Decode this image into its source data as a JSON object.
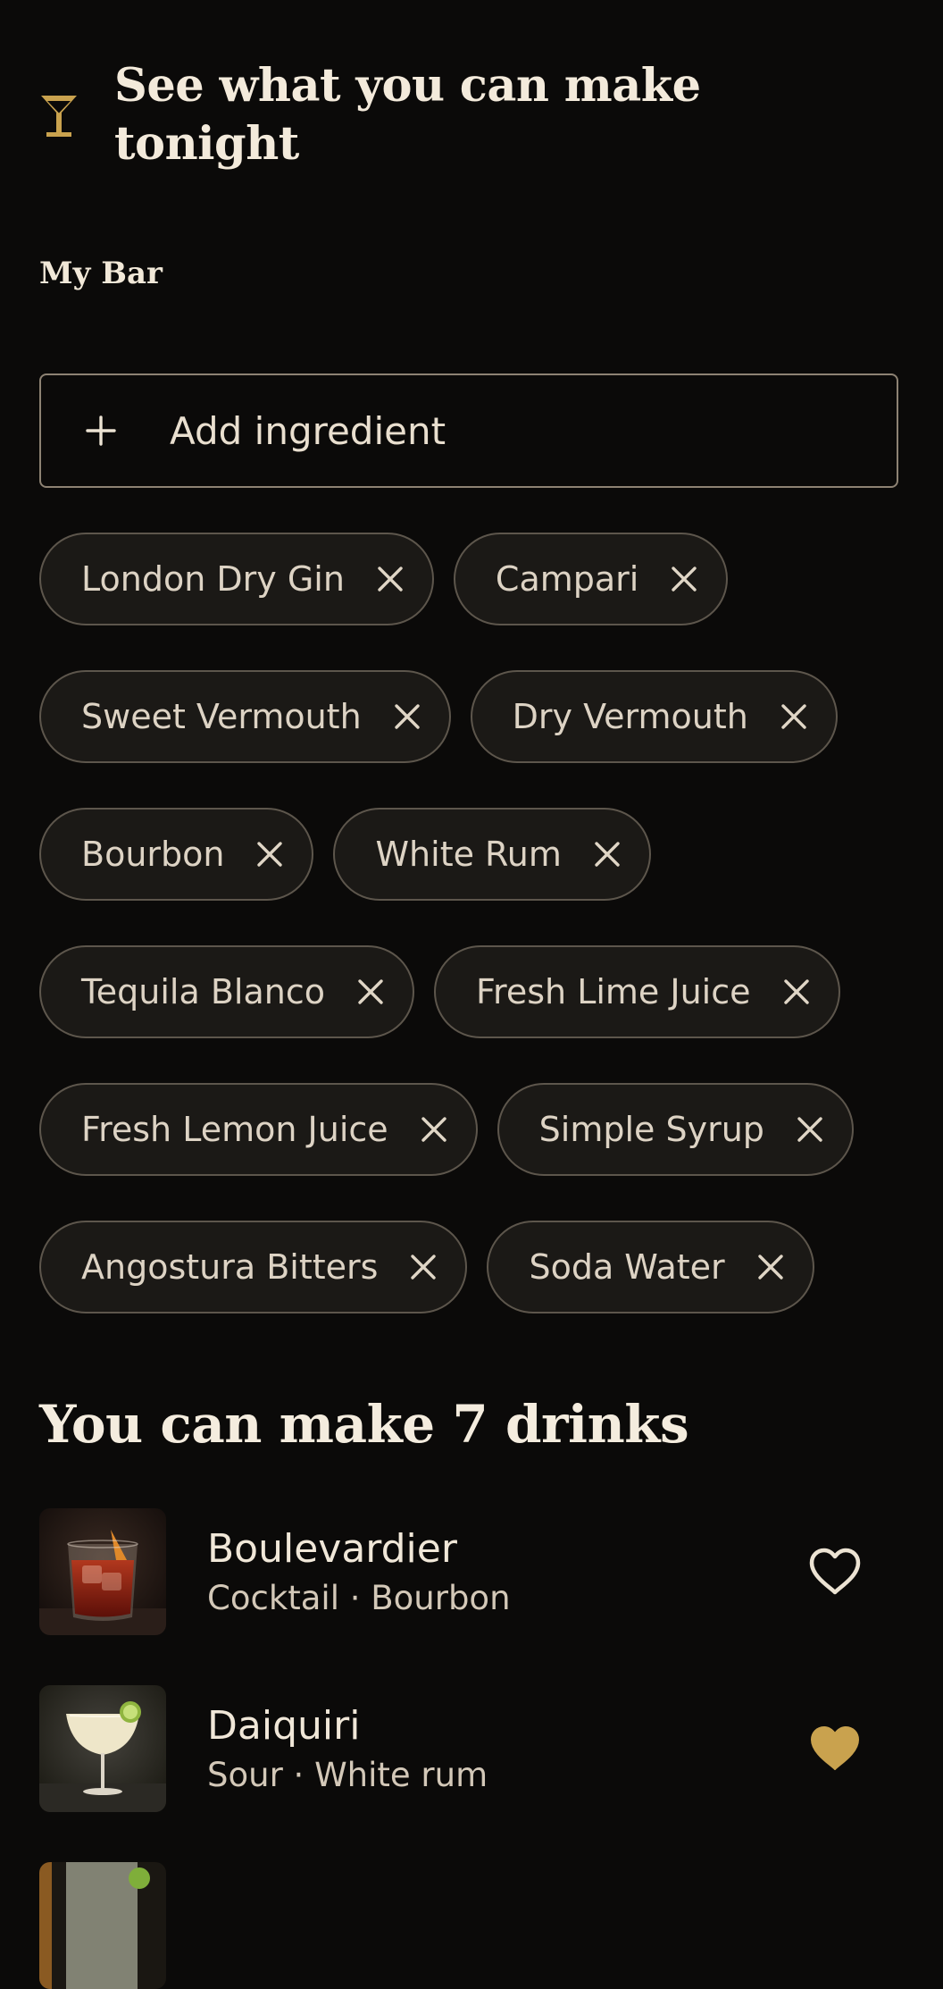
{
  "header": {
    "title": "See what you can make tonight",
    "logo_icon": "cocktail-glass-icon",
    "accent_color": "#c9a24e"
  },
  "my_bar": {
    "label": "My Bar",
    "add_label": "Add ingredient",
    "add_icon": "plus-icon",
    "ingredients": [
      "London Dry Gin",
      "Campari",
      "Sweet Vermouth",
      "Dry Vermouth",
      "Bourbon",
      "White Rum",
      "Tequila Blanco",
      "Fresh Lime Juice",
      "Fresh Lemon Juice",
      "Simple Syrup",
      "Angostura Bitters",
      "Soda Water"
    ]
  },
  "results": {
    "title": "You can make 7 drinks",
    "drinks": [
      {
        "name": "Boulevardier",
        "meta": "Cocktail · Bourbon",
        "favorite": false,
        "image": "boulevardier-rocks-glass"
      },
      {
        "name": "Daiquiri",
        "meta": "Sour · White rum",
        "favorite": true,
        "image": "daiquiri-coupe-glass"
      },
      {
        "name": "",
        "meta": "",
        "favorite": false,
        "image": "partial-drink-glass"
      }
    ]
  }
}
